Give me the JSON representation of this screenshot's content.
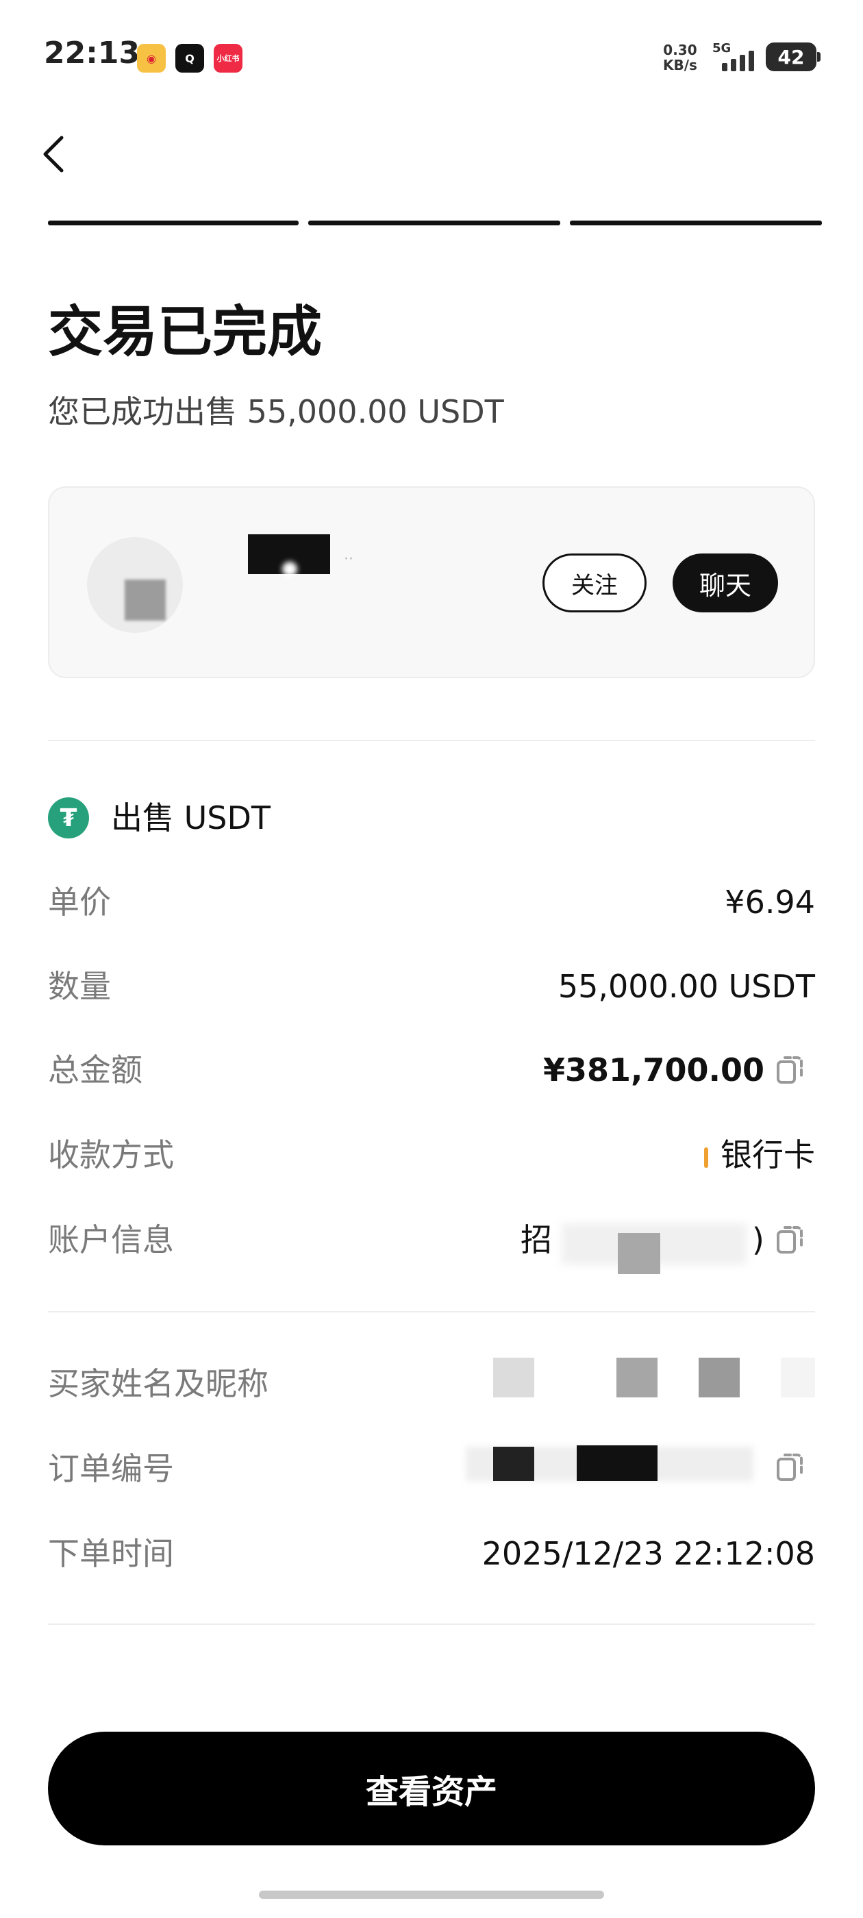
{
  "status_bar": {
    "time": "22:13",
    "net_speed_value": "0.30",
    "net_speed_unit": "KB/s",
    "network": "5G",
    "battery": "42",
    "xhs_icon_text": "小红书"
  },
  "progress": {
    "steps": 3,
    "completed": 3
  },
  "page": {
    "title": "交易已完成",
    "subtitle": "您已成功出售 55,000.00 USDT"
  },
  "user_card": {
    "follow_label": "关注",
    "chat_label": "聊天"
  },
  "order": {
    "section_title": "出售 USDT",
    "unit_price_label": "单价",
    "unit_price_value": "¥6.94",
    "quantity_label": "数量",
    "quantity_value": "55,000.00 USDT",
    "total_label": "总金额",
    "total_value": "¥381,700.00",
    "payment_method_label": "收款方式",
    "payment_method_value": "银行卡",
    "account_info_label": "账户信息",
    "account_info_prefix": "招",
    "account_info_suffix": ")",
    "buyer_label": "买家姓名及昵称",
    "order_no_label": "订单编号",
    "order_time_label": "下单时间",
    "order_time_value": "2025/12/23 22:12:08"
  },
  "actions": {
    "view_assets_label": "查看资产"
  },
  "colors": {
    "accent": "#000000",
    "usdt": "#26a17b",
    "label_gray": "#7a7a7a",
    "bank_mark": "#f0a030"
  }
}
